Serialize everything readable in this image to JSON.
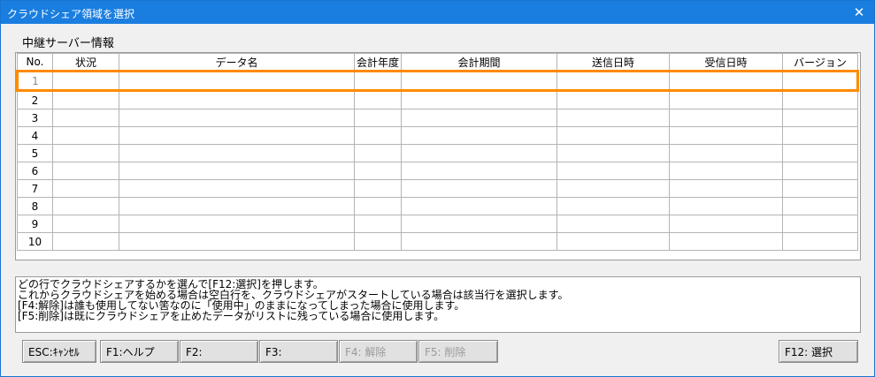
{
  "window": {
    "title": "クラウドシェア領域を選択",
    "close_glyph": "✕"
  },
  "section_label": "中継サーバー情報",
  "table": {
    "columns": [
      "No.",
      "状況",
      "データ名",
      "会計年度",
      "会計期間",
      "送信日時",
      "受信日時",
      "バージョン"
    ],
    "rows": [
      "1",
      "2",
      "3",
      "4",
      "5",
      "6",
      "7",
      "8",
      "9",
      "10"
    ],
    "selected_row": "1"
  },
  "info_lines": [
    "どの行でクラウドシェアするかを選んで[F12:選択]を押します。",
    "これからクラウドシェアを始める場合は空白行を、クラウドシェアがスタートしている場合は該当行を選択します。",
    "[F4:解除]は誰も使用してない筈なのに「使用中」のままになってしまった場合に使用します。",
    "[F5:削除]は既にクラウドシェアを止めたデータがリストに残っている場合に使用します。"
  ],
  "buttons": {
    "esc": "ESC:ｷｬﾝｾﾙ",
    "f1": "F1:ヘルプ",
    "f2": "F2:",
    "f3": "F3:",
    "f4": "F4: 解除",
    "f5": "F5: 削除",
    "f12": "F12: 選択"
  },
  "colors": {
    "title_bar": "#1a7ee0",
    "selection": "#ff8a00"
  }
}
